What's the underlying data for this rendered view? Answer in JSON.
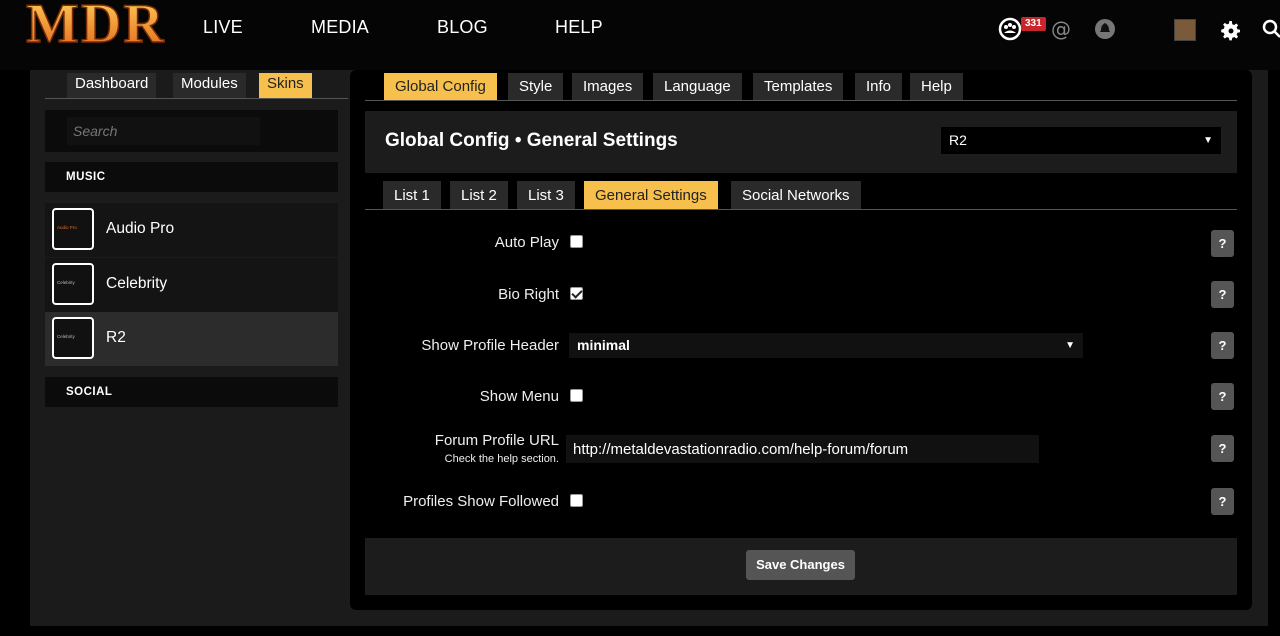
{
  "brand": {
    "logo_text": "MDR"
  },
  "nav": {
    "items": [
      "LIVE",
      "MEDIA",
      "BLOG",
      "HELP"
    ]
  },
  "topbar": {
    "notification_count": "331"
  },
  "left": {
    "tabs": [
      "Dashboard",
      "Modules",
      "Skins"
    ],
    "active_tab": "Skins",
    "search_placeholder": "Search",
    "sections": [
      {
        "title": "MUSIC",
        "items": [
          {
            "name": "Audio Pro",
            "thumb": "Audio Pro"
          },
          {
            "name": "Celebrity",
            "thumb": "Celebrity"
          },
          {
            "name": "R2",
            "thumb": "Celebrity"
          }
        ]
      },
      {
        "title": "SOCIAL",
        "items": []
      }
    ],
    "active_item": "R2"
  },
  "main": {
    "tabs": [
      "Global Config",
      "Style",
      "Images",
      "Language",
      "Templates",
      "Info",
      "Help"
    ],
    "active_tab": "Global Config",
    "title": "Global Config • General Settings",
    "skin_select": "R2",
    "subtabs": [
      "List 1",
      "List 2",
      "List 3",
      "General Settings",
      "Social Networks"
    ],
    "active_subtab": "General Settings",
    "fields": {
      "auto_play": {
        "label": "Auto Play",
        "checked": false
      },
      "bio_right": {
        "label": "Bio Right",
        "checked": true
      },
      "show_profile_header": {
        "label": "Show Profile Header",
        "value": "minimal"
      },
      "show_menu": {
        "label": "Show Menu",
        "checked": false
      },
      "forum_profile_url": {
        "label": "Forum Profile URL",
        "hint": "Check the help section.",
        "value": "http://metaldevastationradio.com/help-forum/forum"
      },
      "profiles_show_followed": {
        "label": "Profiles Show Followed",
        "checked": false
      }
    },
    "help_label": "?",
    "save_label": "Save Changes"
  },
  "colors": {
    "accent": "#f7c04c",
    "logo": "#f08a1c",
    "badge": "#c8262b"
  }
}
